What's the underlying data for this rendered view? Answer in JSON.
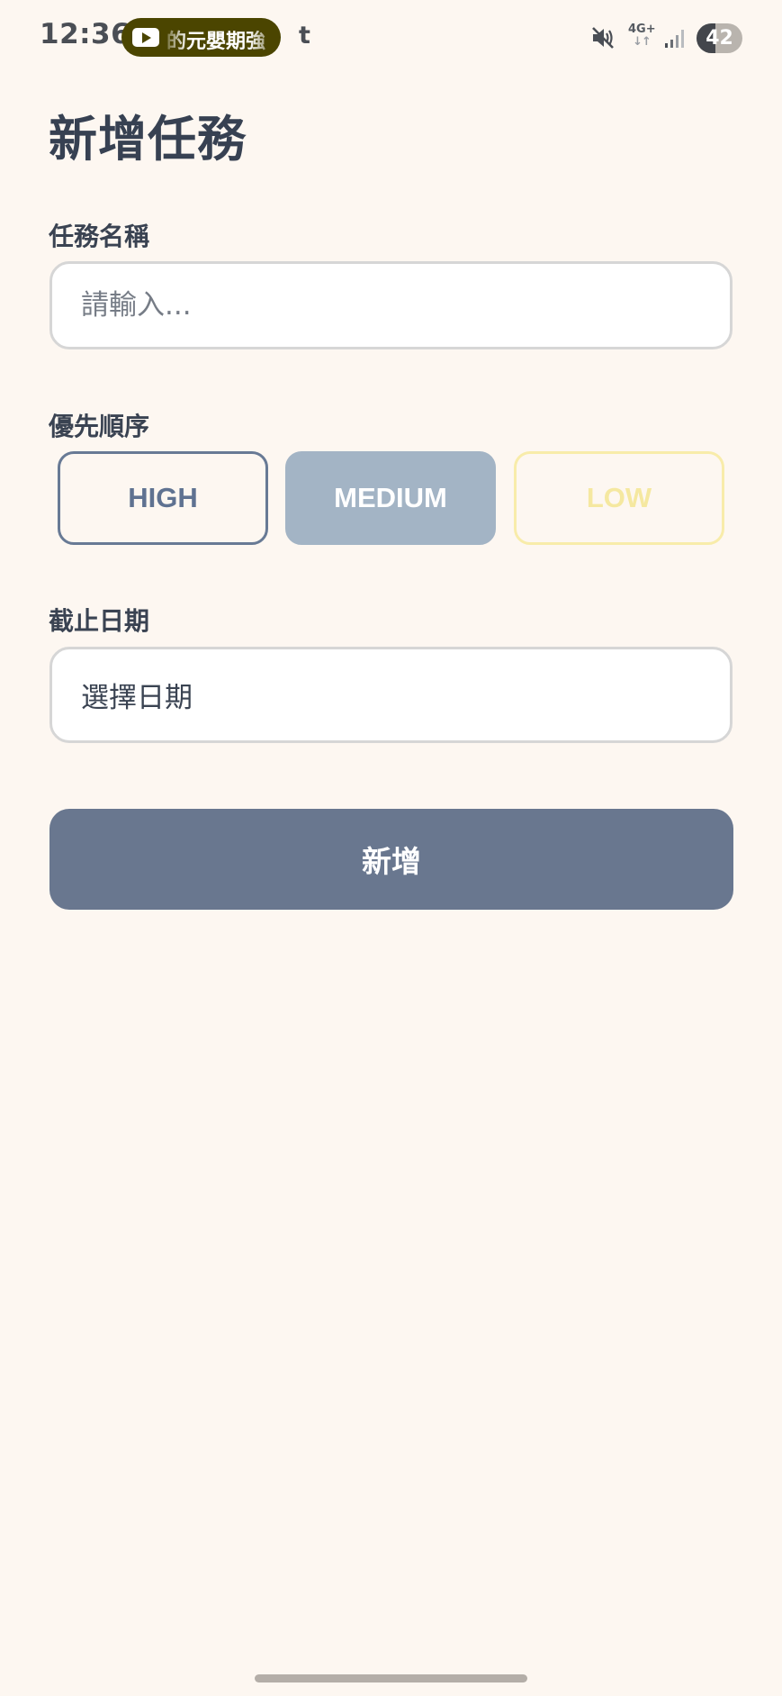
{
  "status_bar": {
    "time": "12:36",
    "media_ticker": "的元嬰期強",
    "notification_glyph": "t",
    "network_type": "4G+",
    "network_arrows": "↓↑",
    "battery_level": "42",
    "icons": [
      "youtube-icon",
      "mute-icon",
      "signal-icon",
      "battery-icon"
    ]
  },
  "form": {
    "title": "新增任務",
    "task_name": {
      "label": "任務名稱",
      "value": "",
      "placeholder": "請輸入..."
    },
    "priority": {
      "label": "優先順序",
      "options": [
        "HIGH",
        "MEDIUM",
        "LOW"
      ],
      "selected": "MEDIUM"
    },
    "due_date": {
      "label": "截止日期",
      "value": "選擇日期"
    },
    "submit_label": "新增"
  },
  "colors": {
    "background": "#fdf7f1",
    "high": "#687a95",
    "medium": "#a3b4c5",
    "low": "#f8ecaa",
    "submit": "#69778f"
  }
}
